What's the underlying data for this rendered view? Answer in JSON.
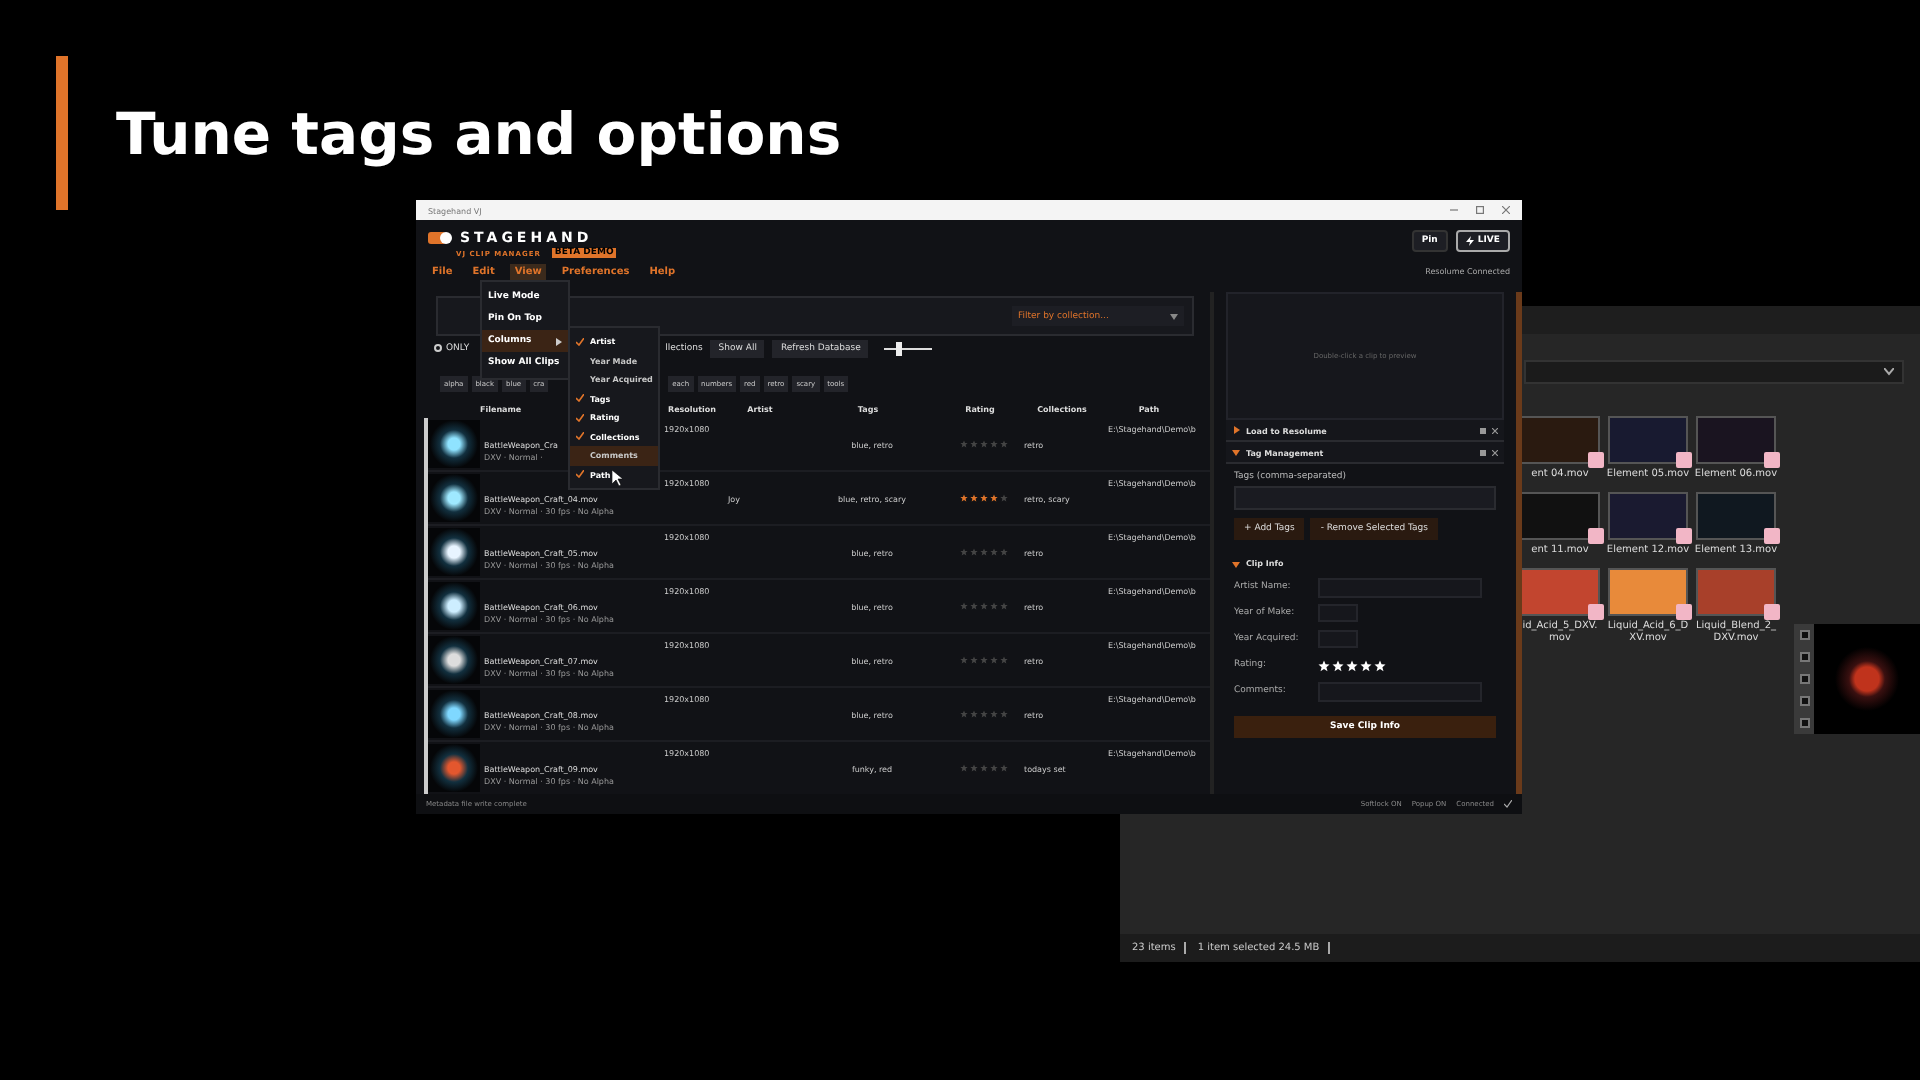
{
  "slide": {
    "title": "Tune tags and options"
  },
  "app": {
    "window_title": "Stagehand VJ",
    "logo": {
      "name": "STAGEHAND",
      "tagline": "VJ CLIP MANAGER",
      "badge": "BETA DEMO"
    },
    "menu": [
      {
        "label": "File",
        "selected": false
      },
      {
        "label": "Edit",
        "selected": false
      },
      {
        "label": "View",
        "selected": true
      },
      {
        "label": "Preferences",
        "selected": false
      },
      {
        "label": "Help",
        "selected": false
      }
    ],
    "header_buttons": [
      {
        "label": "Pin",
        "kind": "plain"
      },
      {
        "label": "LIVE",
        "kind": "live"
      }
    ],
    "connection": "Resolume Connected",
    "view_menu": [
      {
        "label": "Live Mode",
        "kind": "item",
        "highlighted": false
      },
      {
        "label": "Pin On Top",
        "kind": "item",
        "highlighted": false
      },
      {
        "label": "Columns",
        "kind": "submenu",
        "highlighted": true
      },
      {
        "label": "Show All Clips",
        "kind": "item",
        "highlighted": false
      }
    ],
    "columns_menu": [
      {
        "label": "Artist",
        "checked": true,
        "highlighted": false
      },
      {
        "label": "Year Made",
        "checked": false,
        "highlighted": false
      },
      {
        "label": "Year Acquired",
        "checked": false,
        "highlighted": false
      },
      {
        "label": "Tags",
        "checked": true,
        "highlighted": false
      },
      {
        "label": "Rating",
        "checked": true,
        "highlighted": false
      },
      {
        "label": "Collections",
        "checked": true,
        "highlighted": false
      },
      {
        "label": "Comments",
        "checked": false,
        "highlighted": true
      },
      {
        "label": "Path",
        "checked": true,
        "highlighted": false
      }
    ],
    "filter": {
      "placeholder": "Filter by collection..."
    },
    "toolbar": {
      "only_label": "ONLY",
      "only_selected": false,
      "collections_label": "llections",
      "buttons": [
        "Show All",
        "Refresh Database"
      ],
      "thumb_size": {
        "level": 0.3
      }
    },
    "tag_chips": [
      "alpha",
      "black",
      "blue",
      "cra"
    ],
    "tag_chips_more": [
      "each",
      "numbers",
      "red",
      "retro",
      "scary",
      "tools"
    ],
    "table": {
      "columns": [
        "Filename",
        "Resolution",
        "Artist",
        "Tags",
        "Rating",
        "Collections",
        "Path"
      ],
      "rows": [
        {
          "filename": "BattleWeapon_Cra",
          "meta": "DXV · Normal ·",
          "resolution": "1920x1080",
          "artist": "",
          "tags": "blue, retro",
          "stars": 0,
          "collections": "retro",
          "path": "E:\\Stagehand\\Demo\\b"
        },
        {
          "filename": "BattleWeapon_Craft_04.mov",
          "meta": "DXV · Normal · 30 fps · No Alpha",
          "resolution": "1920x1080",
          "artist": "Joy",
          "tags": "blue, retro, scary",
          "stars": 4,
          "collections": "retro, scary",
          "path": "E:\\Stagehand\\Demo\\b"
        },
        {
          "filename": "BattleWeapon_Craft_05.mov",
          "meta": "DXV · Normal · 30 fps · No Alpha",
          "resolution": "1920x1080",
          "artist": "",
          "tags": "blue, retro",
          "stars": 0,
          "collections": "retro",
          "path": "E:\\Stagehand\\Demo\\b"
        },
        {
          "filename": "BattleWeapon_Craft_06.mov",
          "meta": "DXV · Normal · 30 fps · No Alpha",
          "resolution": "1920x1080",
          "artist": "",
          "tags": "blue, retro",
          "stars": 0,
          "collections": "retro",
          "path": "E:\\Stagehand\\Demo\\b"
        },
        {
          "filename": "BattleWeapon_Craft_07.mov",
          "meta": "DXV · Normal · 30 fps · No Alpha",
          "resolution": "1920x1080",
          "artist": "",
          "tags": "blue, retro",
          "stars": 0,
          "collections": "retro",
          "path": "E:\\Stagehand\\Demo\\b"
        },
        {
          "filename": "BattleWeapon_Craft_08.mov",
          "meta": "DXV · Normal · 30 fps · No Alpha",
          "resolution": "1920x1080",
          "artist": "",
          "tags": "blue, retro",
          "stars": 0,
          "collections": "retro",
          "path": "E:\\Stagehand\\Demo\\b"
        },
        {
          "filename": "BattleWeapon_Craft_09.mov",
          "meta": "DXV · Normal · 30 fps · No Alpha",
          "resolution": "1920x1080",
          "artist": "",
          "tags": "funky, red",
          "stars": 0,
          "collections": "todays set",
          "path": "E:\\Stagehand\\Demo\\b"
        }
      ]
    },
    "status": "Metadata file write complete",
    "status_right": [
      "Softlock ON",
      "Popup ON",
      "Connected"
    ],
    "side": {
      "preview_hint": "Double-click a clip to preview",
      "sections": [
        {
          "label": "Load to Resolume",
          "expanded": false
        },
        {
          "label": "Tag Management",
          "expanded": true
        }
      ],
      "tags_label": "Tags (comma-separated)",
      "tag_buttons": [
        "+ Add Tags",
        "- Remove Selected Tags"
      ],
      "clip_info": {
        "title": "Clip Info",
        "expanded": true,
        "fields": [
          {
            "label": "Artist Name:",
            "kind": "text"
          },
          {
            "label": "Year of Make:",
            "kind": "short"
          },
          {
            "label": "Year Acquired:",
            "kind": "short"
          },
          {
            "label": "Rating:",
            "kind": "stars",
            "stars": 5
          },
          {
            "label": "Comments:",
            "kind": "text"
          }
        ],
        "save": "Save Clip Info"
      }
    }
  },
  "explorer": {
    "files": [
      "ent 04.mov",
      "Element 05.mov",
      "Element 06.mov",
      "ent 11.mov",
      "Element 12.mov",
      "Element 13.mov",
      "id_Acid_5_DXV.mov",
      "Liquid_Acid_6_DXV.mov",
      "Liquid_Blend_2_DXV.mov"
    ],
    "status": [
      "23 items",
      "1 item selected  24.5 MB"
    ]
  }
}
